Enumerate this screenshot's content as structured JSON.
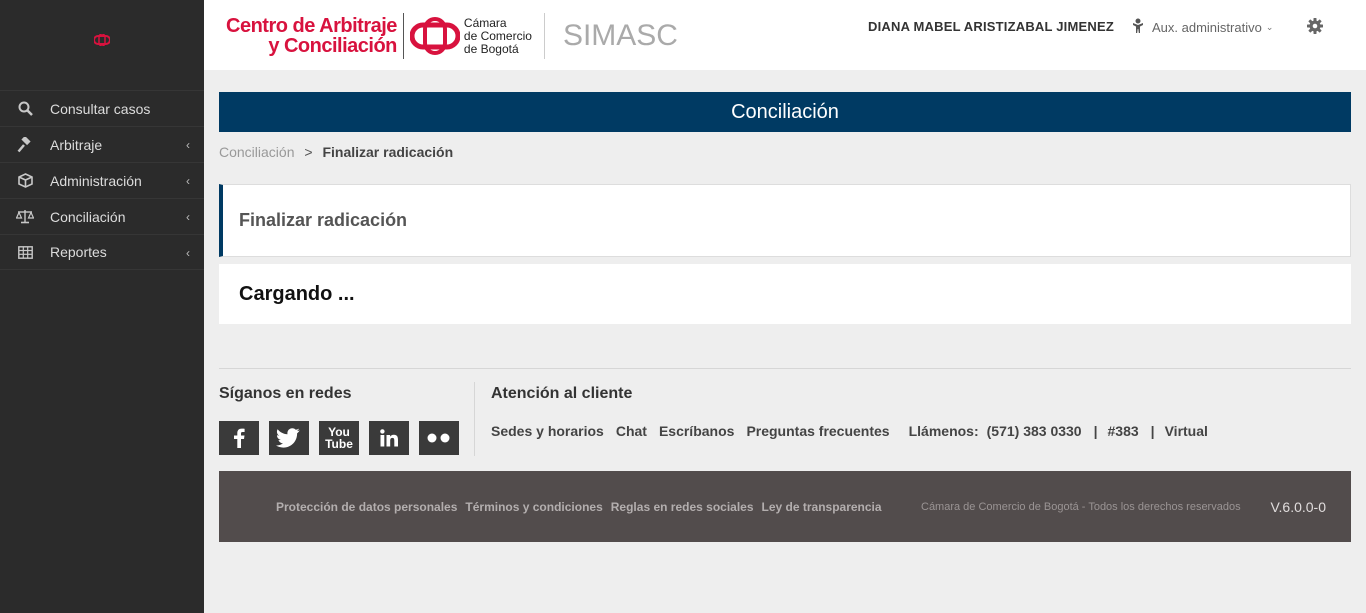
{
  "colors": {
    "accent_navy": "#003a63",
    "brand_red": "#d8123e",
    "sidebar_bg": "#2b2b2b",
    "footer_bg": "#524c4c"
  },
  "sidebar": {
    "items": [
      {
        "label": "Consultar casos",
        "icon": "search-icon"
      },
      {
        "label": "Arbitraje",
        "icon": "gavel-icon"
      },
      {
        "label": "Administración",
        "icon": "cube-icon"
      },
      {
        "label": "Conciliación",
        "icon": "scale-icon"
      },
      {
        "label": "Reportes",
        "icon": "table-icon"
      }
    ]
  },
  "header": {
    "brand_line1": "Centro de Arbitraje",
    "brand_line2": "y Conciliación",
    "ccb_line1": "Cámara",
    "ccb_line2": "de Comercio",
    "ccb_line3": "de Bogotá",
    "app_name": "SIMASC",
    "user_name": "DIANA MABEL ARISTIZABAL JIMENEZ",
    "role": "Aux. administrativo"
  },
  "page": {
    "title": "Conciliación",
    "breadcrumb_parent": "Conciliación",
    "breadcrumb_sep": ">",
    "breadcrumb_current": "Finalizar radicación",
    "panel_title": "Finalizar radicación",
    "loading_text": "Cargando ..."
  },
  "footer": {
    "follow_title": "Síganos en redes",
    "socials": [
      "facebook-icon",
      "twitter-icon",
      "youtube-icon",
      "linkedin-icon",
      "flickr-icon"
    ],
    "youtube_top": "You",
    "youtube_bottom": "Tube",
    "attention_title": "Atención al cliente",
    "links": {
      "sedes": "Sedes y horarios",
      "chat": "Chat",
      "escribanos": "Escríbanos",
      "faq": "Preguntas frecuentes",
      "call_label": "Llámenos:",
      "phone": "(571) 383 0330",
      "pipe": "|",
      "short": "#383",
      "virtual": "Virtual"
    },
    "legal": {
      "privacy": "Protección de datos personales",
      "terms": "Términos y condiciones",
      "social_rules": "Reglas en redes sociales",
      "transparency": "Ley de transparencia"
    },
    "copyright": "Cámara de Comercio de Bogotá - Todos los derechos reservados",
    "version": "V.6.0.0-0"
  }
}
